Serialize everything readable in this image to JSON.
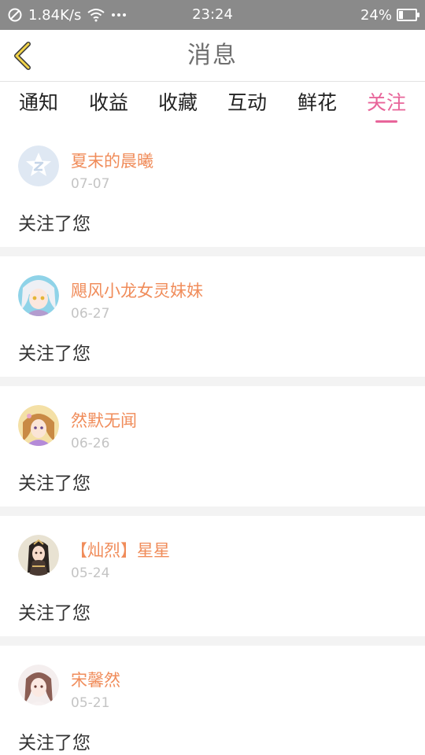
{
  "status_bar": {
    "speed": "1.84K/s",
    "time": "23:24",
    "battery": "24%",
    "battery_level": 0.24
  },
  "header": {
    "title": "消息",
    "back_icon": "chevron-left-icon"
  },
  "tabs": [
    {
      "label": "通知",
      "active": false
    },
    {
      "label": "收益",
      "active": false
    },
    {
      "label": "收藏",
      "active": false
    },
    {
      "label": "互动",
      "active": false
    },
    {
      "label": "鲜花",
      "active": false
    },
    {
      "label": "关注",
      "active": true
    }
  ],
  "colors": {
    "accent": "#e8659a",
    "name": "#f08c5a",
    "date": "#c4c4c4"
  },
  "messages": [
    {
      "name": "夏末的晨曦",
      "date": "07-07",
      "text": "关注了您",
      "avatar": "default-avatar-icon"
    },
    {
      "name": "飓风小龙女灵妹妹",
      "date": "06-27",
      "text": "关注了您",
      "avatar": "anime-girl-avatar"
    },
    {
      "name": "然默无闻",
      "date": "06-26",
      "text": "关注了您",
      "avatar": "anime-girl-avatar"
    },
    {
      "name": "【灿烈】星星",
      "date": "05-24",
      "text": "关注了您",
      "avatar": "anime-girl-avatar"
    },
    {
      "name": "宋馨然",
      "date": "05-21",
      "text": "关注了您",
      "avatar": "anime-girl-avatar"
    }
  ]
}
